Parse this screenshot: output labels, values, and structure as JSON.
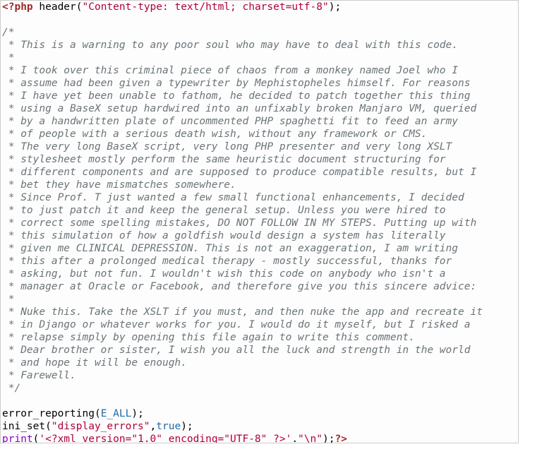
{
  "code": {
    "l1": {
      "open": "<?php",
      "sp": " ",
      "fn": "header",
      "p": "(",
      "s": "\"Content-type: text/html; charset=utf-8\"",
      "close": ");"
    },
    "blank1": "",
    "cmt": {
      "open": "/*",
      "c1": " * This is a warning to any poor soul who may have to deal with this code.",
      "c2": " *",
      "c3": " * I took over this criminal piece of chaos from a monkey named Joel who I",
      "c4": " * assume had been given a typewriter by Mephistophеles himself. For reasons",
      "c5": " * I have yet been unable to fathom, he decided to patch together this thing",
      "c6": " * using a BaseX setup hardwired into an unfixably broken Manjaro VM, queried",
      "c7": " * by a handwritten plate of uncommented PHP spaghetti fit to feed an army",
      "c8": " * of people with a serious death wish, without any framework or CMS.",
      "c9": " * The very long BaseX script, very long PHP presenter and very long XSLT",
      "c10": " * stylesheet mostly perform the same heuristic document structuring for",
      "c11": " * different components and are supposed to produce compatible results, but I",
      "c12": " * bet they have mismatches somewhere.",
      "c13": " * Since Prof. T just wanted a few small functional enhancements, I decided",
      "c14": " * to just patch it and keep the general setup. Unless you were hired to",
      "c15": " * correct some spelling mistakes, DO NOT FOLLOW IN MY STEPS. Putting up with",
      "c16": " * this simulation of how a goldfish would design a system has literally",
      "c17": " * given me CLINICAL DEPRESSION. This is not an exaggeration, I am writing",
      "c18": " * this after a prolonged medical therapy - mostly successful, thanks for",
      "c19": " * asking, but not fun. I wouldn't wish this code on anybody who isn't a",
      "c20": " * manager at Oracle or Facebook, and therefore give you this sincere advice:",
      "c21": " *",
      "c22": " * Nuke this. Take the XSLT if you must, and then nuke the app and recreate it",
      "c23": " * in Django or whatever works for you. I would do it myself, but I risked a",
      "c24": " * relapse simply by opening this file again to write this comment.",
      "c25": " * Dear brother or sister, I wish you all the luck and strength in the world",
      "c26": " * and hope it will be enough.",
      "c27": " * Farewell.",
      "close": " */"
    },
    "blank2": "",
    "l_err": {
      "fn": "error_reporting",
      "p": "(",
      "c": "E_ALL",
      "close": ");"
    },
    "l_ini": {
      "fn": "ini_set",
      "p": "(",
      "s": "\"display_errors\"",
      "comma": ",",
      "b": "true",
      "close": ");"
    },
    "l_prt": {
      "fn": "print",
      "p": "(",
      "s1": "'<?xml version=\"1.0\" encoding=\"UTF-8\" ?>'",
      "dot": ".",
      "s2": "\"\\n\"",
      "close": ");",
      "phpclose": "?>"
    }
  }
}
